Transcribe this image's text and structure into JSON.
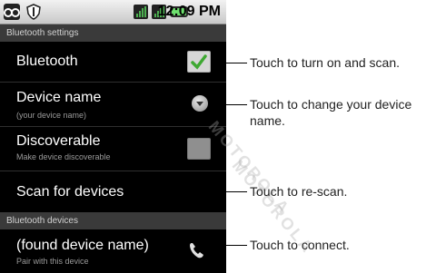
{
  "status_bar": {
    "time": "12:09 PM"
  },
  "sections": {
    "bluetooth_settings": "Bluetooth settings",
    "bluetooth_devices": "Bluetooth devices"
  },
  "items": {
    "bluetooth": {
      "title": "Bluetooth",
      "checked": true
    },
    "device_name": {
      "title": "Device name",
      "subtitle": "(your device name)"
    },
    "discoverable": {
      "title": "Discoverable",
      "subtitle": "Make device discoverable",
      "checked": false
    },
    "scan": {
      "title": "Scan for devices"
    },
    "found_device": {
      "title": "(found device name)",
      "subtitle": "Pair with this device"
    }
  },
  "callouts": {
    "bluetooth": "Touch to turn on and scan.",
    "device_name_1": "Touch to change your device",
    "device_name_2": "name.",
    "scan": "Touch to re-scan.",
    "connect": "Touch to connect."
  },
  "colors": {
    "check_green": "#3ea832",
    "section_header_bg": "#3a3a3a"
  }
}
